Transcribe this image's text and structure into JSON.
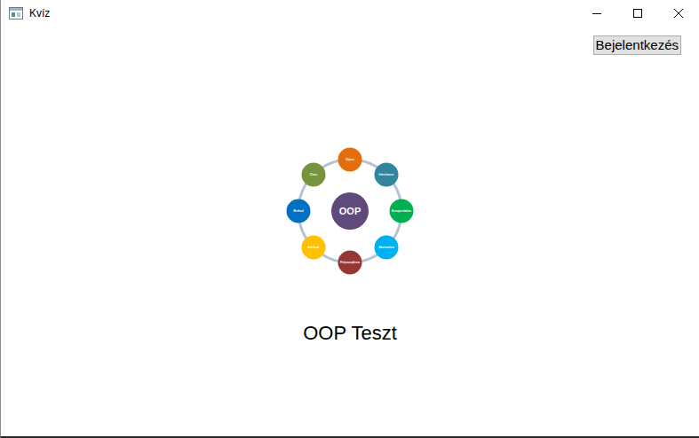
{
  "window": {
    "title": "Kvíz"
  },
  "login_button": "Bejelentkezés",
  "diagram": {
    "center": {
      "label": "OOP",
      "color": "#604a7b"
    },
    "nodes": [
      {
        "label": "Object",
        "color": "#e46c0a"
      },
      {
        "label": "Inheritance",
        "color": "#31859c"
      },
      {
        "label": "Encapsulation",
        "color": "#00b050"
      },
      {
        "label": "Abstraction",
        "color": "#00b0f0"
      },
      {
        "label": "Polymorphism",
        "color": "#953735"
      },
      {
        "label": "Attribute",
        "color": "#ffc000"
      },
      {
        "label": "Method",
        "color": "#0070c0"
      },
      {
        "label": "Class",
        "color": "#77933c"
      }
    ]
  },
  "title": "OOP Teszt"
}
